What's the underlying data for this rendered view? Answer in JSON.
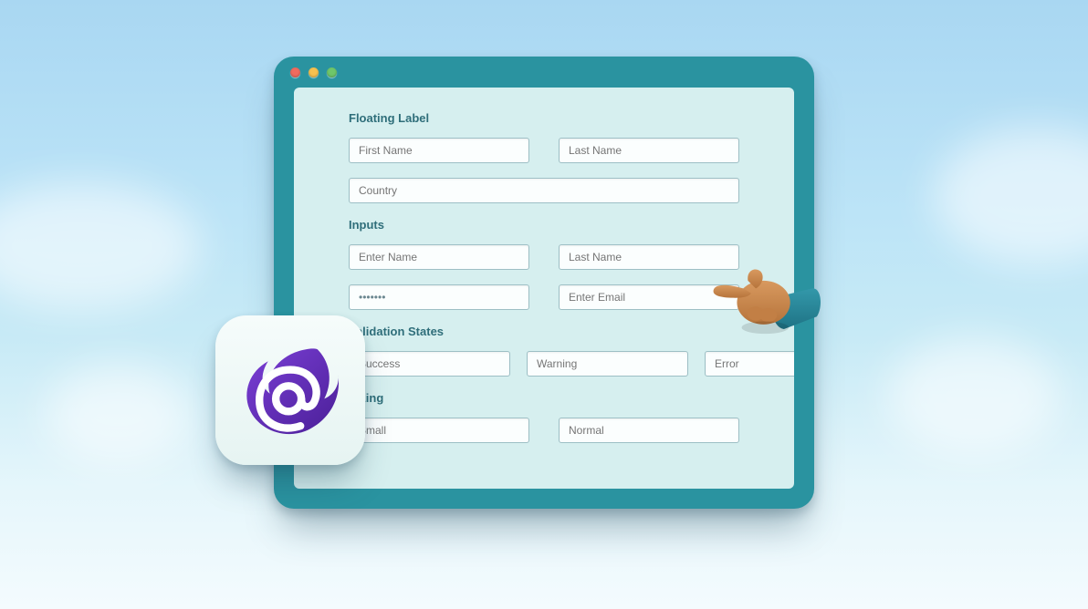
{
  "sections": {
    "floating_label": {
      "title": "Floating Label",
      "first_name": "First Name",
      "last_name": "Last Name",
      "country": "Country"
    },
    "inputs": {
      "title": "Inputs",
      "enter_name": "Enter Name",
      "last_name": "Last Name",
      "password": "•••••••",
      "enter_email": "Enter Email"
    },
    "validation": {
      "title": "Validation States",
      "success": "Success",
      "warning": "Warning",
      "error": "Error"
    },
    "sizing": {
      "title": "Sizing",
      "small": "Small",
      "normal": "Normal"
    }
  },
  "colors": {
    "window_frame": "#2a93a0",
    "pane_bg": "#d6efef",
    "heading": "#2f6e7a",
    "input_border": "#9dbfc5",
    "brand_purple": "#5b2fb1"
  }
}
